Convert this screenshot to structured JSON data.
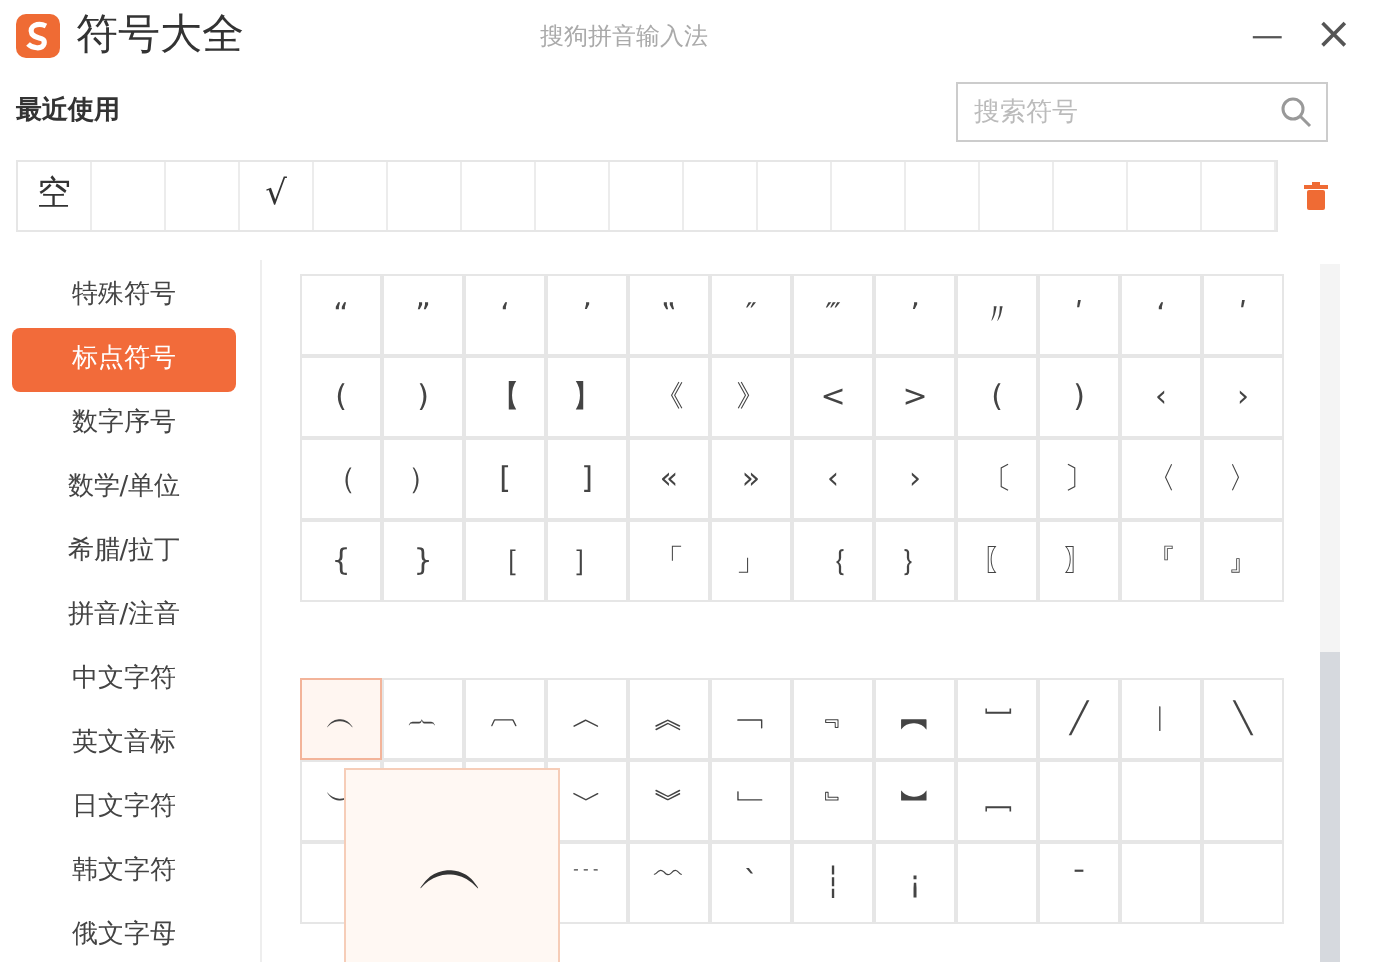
{
  "window": {
    "title": "符号大全",
    "app_name": "搜狗拼音输入法",
    "minimize": "—",
    "close": "×"
  },
  "recent": {
    "label": "最近使用",
    "symbols": [
      {
        "kind": "symbol",
        "symbol": "空"
      },
      {
        "kind": "empty"
      },
      {
        "kind": "empty"
      },
      {
        "kind": "symbol",
        "symbol": "√"
      }
    ]
  },
  "search": {
    "placeholder": "搜索符号"
  },
  "sidebar": {
    "items": [
      {
        "label": "特殊符号",
        "selected": false
      },
      {
        "label": "标点符号",
        "selected": true
      },
      {
        "label": "数字序号",
        "selected": false
      },
      {
        "label": "数学/单位",
        "selected": false
      },
      {
        "label": "希腊/拉丁",
        "selected": false
      },
      {
        "label": "拼音/注音",
        "selected": false
      },
      {
        "label": "中文字符",
        "selected": false
      },
      {
        "label": "英文音标",
        "selected": false
      },
      {
        "label": "日文字符",
        "selected": false
      },
      {
        "label": "韩文字符",
        "selected": false
      },
      {
        "label": "俄文字母",
        "selected": false
      }
    ]
  },
  "symbol_groups": [
    {
      "rows": [
        [
          {
            "symbol": "“",
            "selected": false
          },
          {
            "symbol": "”",
            "selected": false
          },
          {
            "symbol": "‘",
            "selected": false
          },
          {
            "symbol": "’",
            "selected": false
          },
          {
            "symbol": "‟",
            "selected": false
          },
          {
            "symbol": "″",
            "selected": false
          },
          {
            "symbol": "‴",
            "selected": false
          },
          {
            "symbol": "ʼ",
            "selected": false
          },
          {
            "symbol": "〃",
            "selected": false
          },
          {
            "symbol": "ʹ",
            "selected": false
          },
          {
            "symbol": "ʻ",
            "selected": false
          },
          {
            "symbol": "ʹ",
            "selected": false
          }
        ],
        [
          {
            "symbol": "(",
            "selected": false
          },
          {
            "symbol": ")",
            "selected": false
          },
          {
            "symbol": "【",
            "selected": false
          },
          {
            "symbol": "】",
            "selected": false
          },
          {
            "symbol": "《",
            "selected": false
          },
          {
            "symbol": "》",
            "selected": false
          },
          {
            "symbol": "<",
            "selected": false
          },
          {
            "symbol": ">",
            "selected": false
          },
          {
            "symbol": "(",
            "selected": false
          },
          {
            "symbol": ")",
            "selected": false
          },
          {
            "symbol": "‹",
            "selected": false
          },
          {
            "symbol": "›",
            "selected": false
          }
        ],
        [
          {
            "symbol": "（",
            "selected": false
          },
          {
            "symbol": "）",
            "selected": false
          },
          {
            "symbol": "[",
            "selected": false
          },
          {
            "symbol": "]",
            "selected": false
          },
          {
            "symbol": "«",
            "selected": false
          },
          {
            "symbol": "»",
            "selected": false
          },
          {
            "symbol": "‹",
            "selected": false
          },
          {
            "symbol": "›",
            "selected": false
          },
          {
            "symbol": "〔",
            "selected": false
          },
          {
            "symbol": "〕",
            "selected": false
          },
          {
            "symbol": "〈",
            "selected": false
          },
          {
            "symbol": "〉",
            "selected": false
          }
        ],
        [
          {
            "symbol": "{",
            "selected": false
          },
          {
            "symbol": "}",
            "selected": false
          },
          {
            "symbol": "［",
            "selected": false
          },
          {
            "symbol": "］",
            "selected": false
          },
          {
            "symbol": "「",
            "selected": false
          },
          {
            "symbol": "」",
            "selected": false
          },
          {
            "symbol": "｛",
            "selected": false
          },
          {
            "symbol": "｝",
            "selected": false
          },
          {
            "symbol": "〖",
            "selected": false
          },
          {
            "symbol": "〗",
            "selected": false
          },
          {
            "symbol": "『",
            "selected": false
          },
          {
            "symbol": "』",
            "selected": false
          }
        ]
      ]
    },
    {
      "rows": [
        [
          {
            "symbol": "︵",
            "selected": true
          },
          {
            "symbol": "︷",
            "selected": false
          },
          {
            "symbol": "︹",
            "selected": false
          },
          {
            "symbol": "︿",
            "selected": false
          },
          {
            "symbol": "︽",
            "selected": false
          },
          {
            "symbol": "﹁",
            "selected": false
          },
          {
            "symbol": "﹃",
            "selected": false
          },
          {
            "symbol": "︻",
            "selected": false
          },
          {
            "symbol": "﹇",
            "selected": false
          },
          {
            "symbol": "╱",
            "selected": false
          },
          {
            "symbol": "︱",
            "selected": false
          },
          {
            "symbol": "╲",
            "selected": false
          }
        ],
        [
          {
            "symbol": "︶",
            "selected": false
          },
          "",
          "",
          {
            "symbol": "﹀",
            "selected": false
          },
          {
            "symbol": "︾",
            "selected": false
          },
          {
            "symbol": "﹂",
            "selected": false
          },
          {
            "symbol": "﹄",
            "selected": false
          },
          {
            "symbol": "︼",
            "selected": false
          },
          {
            "symbol": "﹈",
            "selected": false
          },
          {
            "selected": false
          },
          {
            "selected": false
          },
          {
            "selected": false
          }
        ],
        [
          {
            "selected": false
          },
          "",
          "",
          {
            "symbol": "﹉",
            "selected": false
          },
          {
            "symbol": "﹌",
            "selected": false
          },
          {
            "symbol": "ˋ",
            "selected": false
          },
          {
            "symbol": "┆",
            "selected": false
          },
          {
            "symbol": "¡",
            "selected": false
          },
          {
            "selected": false
          },
          {
            "symbol": "ˉ",
            "selected": false
          },
          {
            "selected": false
          },
          {
            "selected": false
          }
        ]
      ]
    }
  ],
  "preview": {
    "symbol": "︵"
  }
}
